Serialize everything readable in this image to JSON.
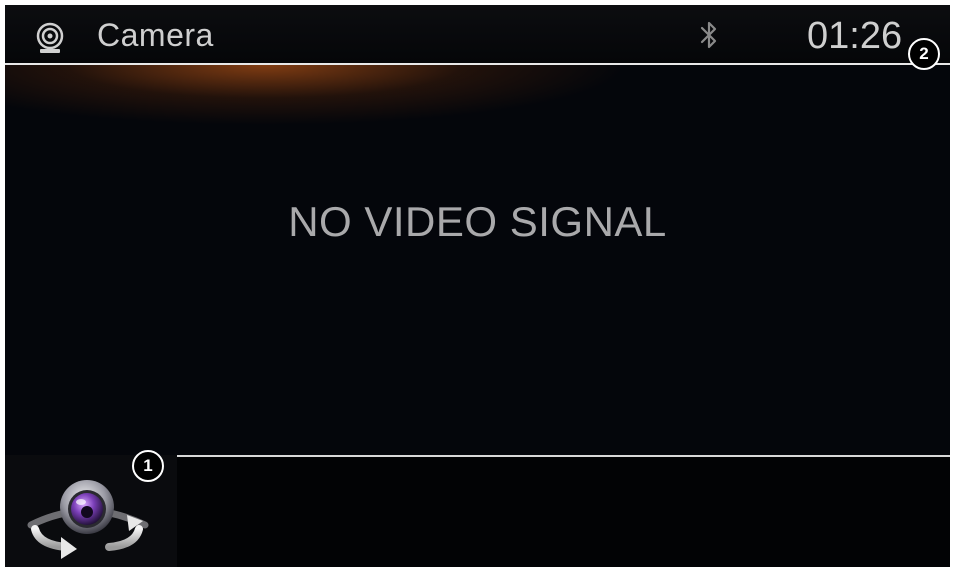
{
  "header": {
    "icon": "camera-icon",
    "title": "Camera",
    "bluetooth_icon": "bluetooth-icon",
    "clock": "01:26"
  },
  "main": {
    "message": "NO VIDEO SIGNAL"
  },
  "bottom": {
    "rotate_button_icon": "camera-rotate-icon"
  },
  "callouts": {
    "one": "1",
    "two": "2"
  },
  "colors": {
    "background": "#04060b",
    "text": "#cfcfcf",
    "divider": "#e8e8e8",
    "accent_glow": "#964614"
  }
}
